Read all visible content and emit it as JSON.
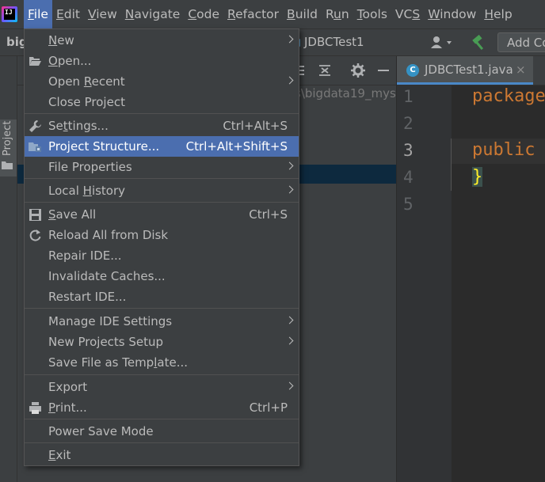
{
  "app": {
    "logo_text": "IJ"
  },
  "menubar": {
    "items": [
      {
        "pre": "",
        "mn": "F",
        "post": "ile"
      },
      {
        "pre": "",
        "mn": "E",
        "post": "dit"
      },
      {
        "pre": "",
        "mn": "V",
        "post": "iew"
      },
      {
        "pre": "",
        "mn": "N",
        "post": "avigate"
      },
      {
        "pre": "",
        "mn": "C",
        "post": "ode"
      },
      {
        "pre": "",
        "mn": "R",
        "post": "efactor"
      },
      {
        "pre": "",
        "mn": "B",
        "post": "uild"
      },
      {
        "pre": "R",
        "mn": "u",
        "post": "n"
      },
      {
        "pre": "",
        "mn": "T",
        "post": "ools"
      },
      {
        "pre": "VC",
        "mn": "S",
        "post": ""
      },
      {
        "pre": "",
        "mn": "W",
        "post": "indow"
      },
      {
        "pre": "",
        "mn": "H",
        "post": "elp"
      }
    ]
  },
  "navbar": {
    "project": "big",
    "file": "JDBCTest1",
    "add_config": "Add Co"
  },
  "toolstrip": {
    "project_label": "Project"
  },
  "project_panel": {
    "path": "s\\bigdata19_mys"
  },
  "editor": {
    "tab_label": "JDBCTest1.java",
    "tab_icon": "C",
    "tab_close": "×",
    "line_numbers": [
      "1",
      "2",
      "3",
      "4",
      "5"
    ],
    "code_lines": [
      "package",
      "",
      "public",
      "}",
      ""
    ]
  },
  "file_menu": {
    "items": [
      {
        "pre": "",
        "mn": "N",
        "post": "ew",
        "shortcut": "",
        "submenu": true,
        "icon": ""
      },
      {
        "pre": "",
        "mn": "O",
        "post": "pen...",
        "shortcut": "",
        "submenu": false,
        "icon": "folder-open-icon"
      },
      {
        "pre": "Open ",
        "mn": "R",
        "post": "ecent",
        "shortcut": "",
        "submenu": true,
        "icon": ""
      },
      {
        "pre": "Close Project",
        "mn": "",
        "post": "",
        "shortcut": "",
        "submenu": false,
        "icon": ""
      },
      {
        "pre": "Se",
        "mn": "t",
        "post": "tings...",
        "shortcut": "Ctrl+Alt+S",
        "submenu": false,
        "icon": "wrench-icon"
      },
      {
        "pre": "Project Structure...",
        "mn": "",
        "post": "",
        "shortcut": "Ctrl+Alt+Shift+S",
        "submenu": false,
        "icon": "project-structure-icon"
      },
      {
        "pre": "File Properties",
        "mn": "",
        "post": "",
        "shortcut": "",
        "submenu": true,
        "icon": ""
      },
      {
        "pre": "Local ",
        "mn": "H",
        "post": "istory",
        "shortcut": "",
        "submenu": true,
        "icon": ""
      },
      {
        "pre": "",
        "mn": "S",
        "post": "ave All",
        "shortcut": "Ctrl+S",
        "submenu": false,
        "icon": "save-icon"
      },
      {
        "pre": "Reload All from Disk",
        "mn": "",
        "post": "",
        "shortcut": "",
        "submenu": false,
        "icon": "reload-icon"
      },
      {
        "pre": "Repair IDE...",
        "mn": "",
        "post": "",
        "shortcut": "",
        "submenu": false,
        "icon": ""
      },
      {
        "pre": "Invalidate Caches...",
        "mn": "",
        "post": "",
        "shortcut": "",
        "submenu": false,
        "icon": ""
      },
      {
        "pre": "Restart IDE...",
        "mn": "",
        "post": "",
        "shortcut": "",
        "submenu": false,
        "icon": ""
      },
      {
        "pre": "Manage IDE Settings",
        "mn": "",
        "post": "",
        "shortcut": "",
        "submenu": true,
        "icon": ""
      },
      {
        "pre": "New Projects Setup",
        "mn": "",
        "post": "",
        "shortcut": "",
        "submenu": true,
        "icon": ""
      },
      {
        "pre": "Save File as Temp",
        "mn": "l",
        "post": "ate...",
        "shortcut": "",
        "submenu": false,
        "icon": ""
      },
      {
        "pre": "Export",
        "mn": "",
        "post": "",
        "shortcut": "",
        "submenu": true,
        "icon": ""
      },
      {
        "pre": "",
        "mn": "P",
        "post": "rint...",
        "shortcut": "Ctrl+P",
        "submenu": false,
        "icon": "print-icon"
      },
      {
        "pre": "Power Save Mode",
        "mn": "",
        "post": "",
        "shortcut": "",
        "submenu": false,
        "icon": ""
      },
      {
        "pre": "",
        "mn": "E",
        "post": "xit",
        "shortcut": "",
        "submenu": false,
        "icon": ""
      }
    ]
  }
}
